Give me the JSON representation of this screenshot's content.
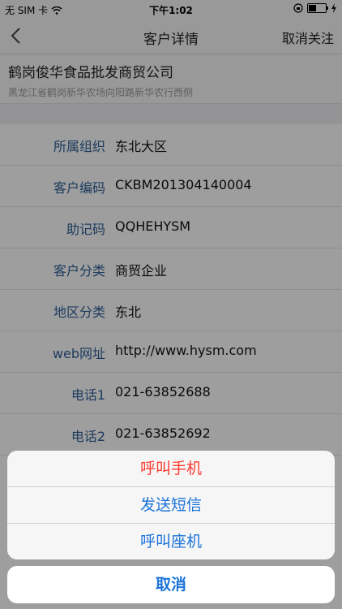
{
  "status_bar": {
    "carrier": "无 SIM 卡",
    "time": "下午1:02"
  },
  "nav": {
    "title": "客户详情",
    "right_action": "取消关注"
  },
  "company": {
    "name": "鹤岗俊华食品批发商贸公司",
    "address": "黑龙江省鹤岗新华农场向阳路新华农行西侧"
  },
  "details": [
    {
      "label": "所属组织",
      "value": "东北大区"
    },
    {
      "label": "客户编码",
      "value": "CKBM201304140004"
    },
    {
      "label": "助记码",
      "value": "QQHEHYSM"
    },
    {
      "label": "客户分类",
      "value": "商贸企业"
    },
    {
      "label": "地区分类",
      "value": "东北"
    },
    {
      "label": "web网址",
      "value": "http://www.hysm.com"
    },
    {
      "label": "电话1",
      "value": "021-63852688"
    },
    {
      "label": "电话2",
      "value": "021-63852692"
    }
  ],
  "action_sheet": {
    "options": [
      "呼叫手机",
      "发送短信",
      "呼叫座机"
    ],
    "cancel": "取消"
  },
  "colors": {
    "label_blue": "#2f5f98",
    "action_blue": "#1a73d9",
    "destructive_red": "#ff3b30"
  }
}
